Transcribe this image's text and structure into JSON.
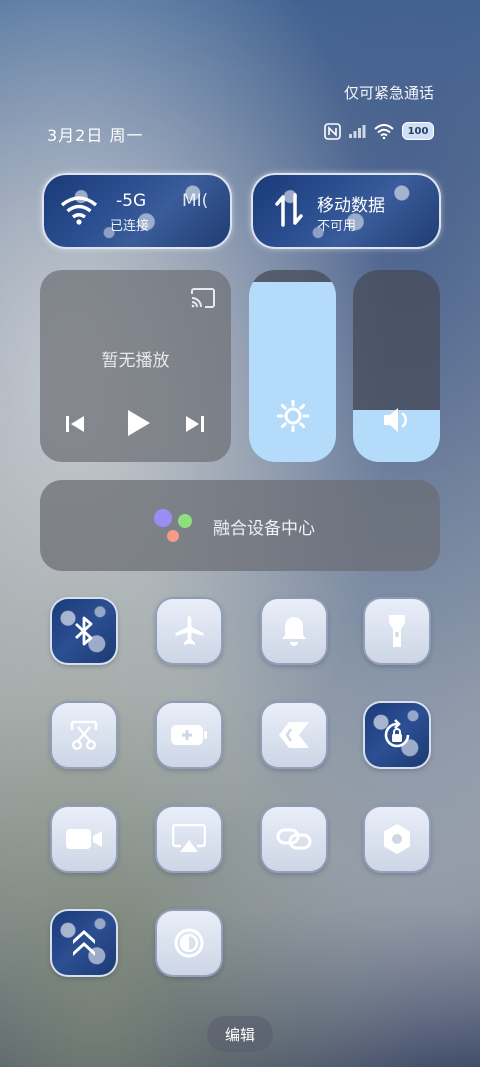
{
  "status": {
    "emergency_text": "仅可紧急通话",
    "date": "3月2日 周一",
    "battery": "100"
  },
  "network": {
    "wifi": {
      "name": "-5G",
      "status": "已连接",
      "extra": "MI("
    },
    "mobile": {
      "name": "移动数据",
      "status": "不可用"
    }
  },
  "media": {
    "title": "暂无播放"
  },
  "sliders": {
    "brightness_level": 0.94,
    "volume_level": 0.27
  },
  "device_hub": {
    "label": "融合设备中心"
  },
  "footer": {
    "edit_label": "编辑"
  }
}
